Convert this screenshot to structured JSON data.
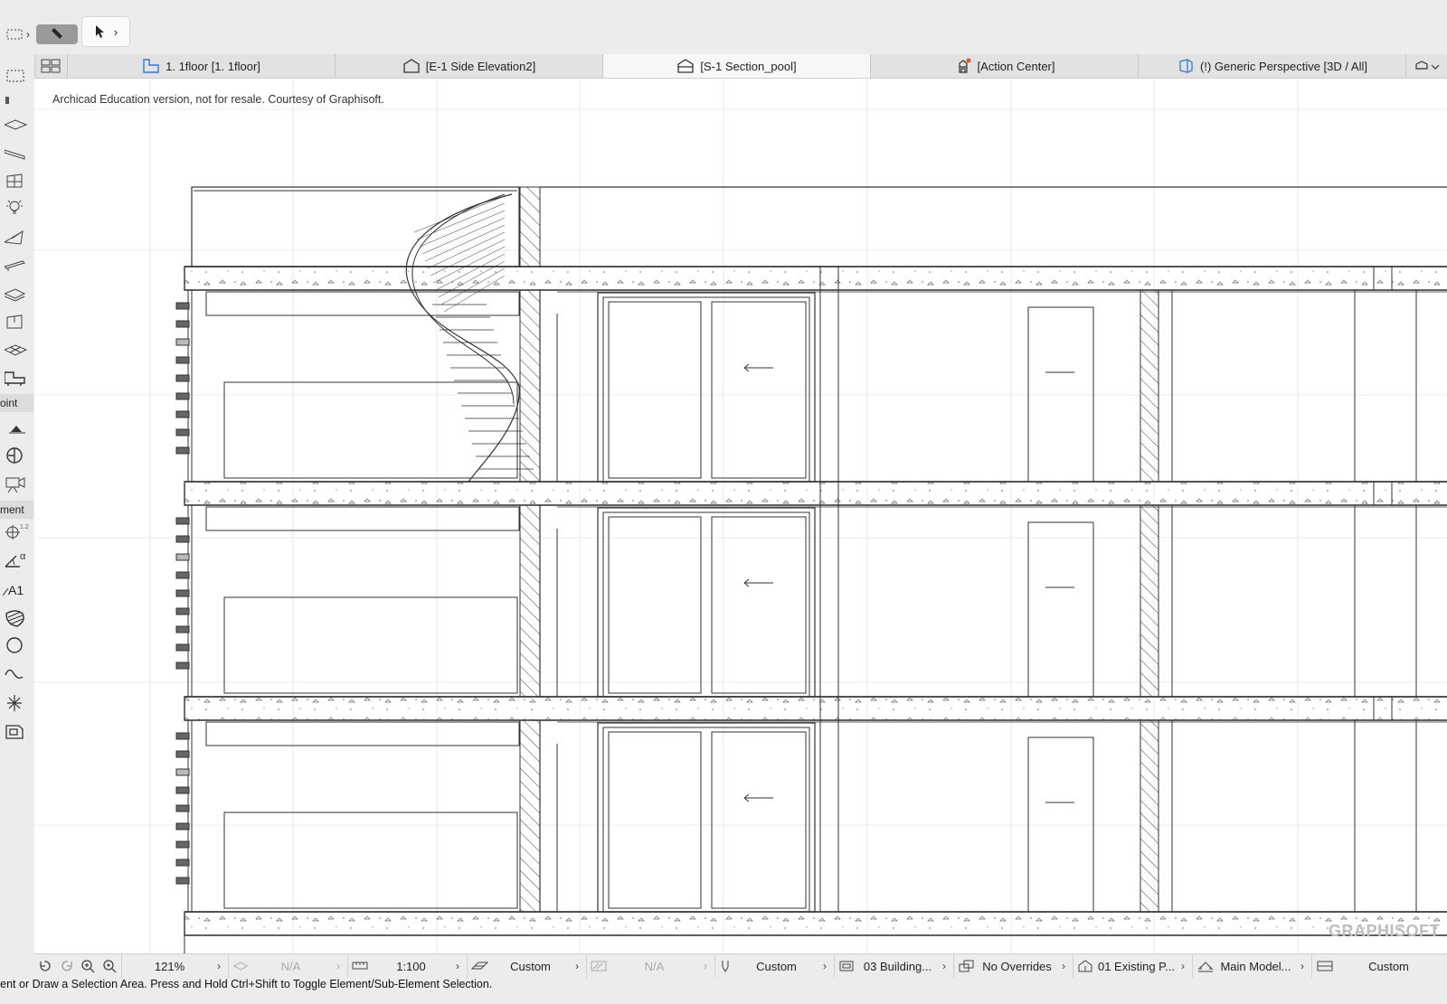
{
  "toolbar": {
    "selection_chevron": "›",
    "arrow_chevron": "›"
  },
  "tabs": [
    {
      "label": "1. 1floor  [1. 1floor]",
      "icon": "floor-plan-icon"
    },
    {
      "label": "[E-1 Side Elevation2]",
      "icon": "elevation-icon"
    },
    {
      "label": "[S-1 Section_pool]",
      "icon": "section-icon",
      "active": true
    },
    {
      "label": "[Action Center]",
      "icon": "action-center-icon"
    },
    {
      "label": "(!) Generic Perspective [3D / All]",
      "icon": "perspective-icon"
    }
  ],
  "toolbox": {
    "label_point": "oint",
    "label_element": "ment",
    "a1_text": "A1"
  },
  "canvas": {
    "watermark": "Archicad Education version, not for resale. Courtesy of Graphisoft.",
    "logo": "GRAPHISOFT"
  },
  "statusbar": {
    "zoom": "121%",
    "layer_combo": "N/A",
    "scale": "1:100",
    "structure_display": "Custom",
    "pen_set": "N/A",
    "model_view": "Custom",
    "renovation": "03 Building...",
    "graphic_override": "No Overrides",
    "renovation_filter": "01 Existing P...",
    "partial_structure": "Main Model...",
    "dimension": "Custom"
  },
  "hint": "lement or Draw a Selection Area. Press and Hold Ctrl+Shift to Toggle Element/Sub-Element Selection.",
  "colors": {
    "active_tab": "#f7f7f7",
    "tab_bar": "#e2e2e2",
    "alert_dot": "#e8552b",
    "accent_blue": "#2f7bd1"
  }
}
